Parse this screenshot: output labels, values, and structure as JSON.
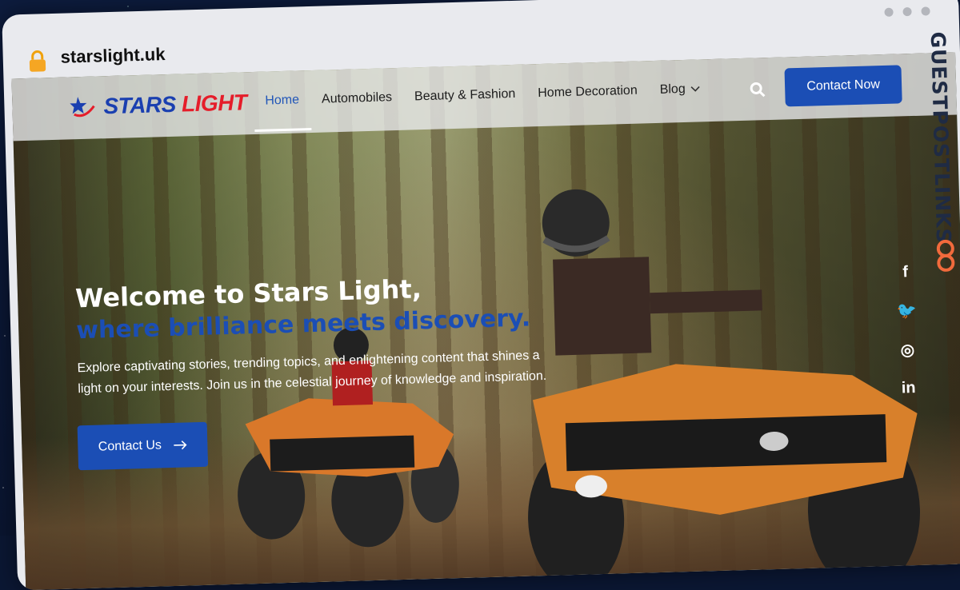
{
  "browser": {
    "url": "starslight.uk"
  },
  "header": {
    "logo": {
      "stars": "STARS",
      "light": "LIGHT"
    },
    "nav": [
      {
        "label": "Home"
      },
      {
        "label": "Automobiles"
      },
      {
        "label": "Beauty & Fashion"
      },
      {
        "label": "Home Decoration"
      },
      {
        "label": "Blog"
      }
    ],
    "contact_button": "Contact Now"
  },
  "hero": {
    "title": "Welcome to Stars Light,",
    "subtitle": "where brilliance meets discovery.",
    "description": "Explore captivating stories, trending topics, and enlightening content that shines a light on your interests. Join us in the celestial journey of knowledge and inspiration.",
    "cta": "Contact Us"
  },
  "social": {
    "facebook": "f",
    "twitter": "🐦",
    "instagram": "◎",
    "linkedin": "in"
  },
  "watermark": "GUESTPOSTLINKS",
  "icons": {
    "lock": "lock-icon",
    "search": "search-icon",
    "chevron": "chevron-down-icon",
    "arrow": "arrow-right-icon"
  },
  "colors": {
    "accent": "#1b4eb5",
    "logo_red": "#e51d2a",
    "logo_blue": "#1a3fb0"
  }
}
